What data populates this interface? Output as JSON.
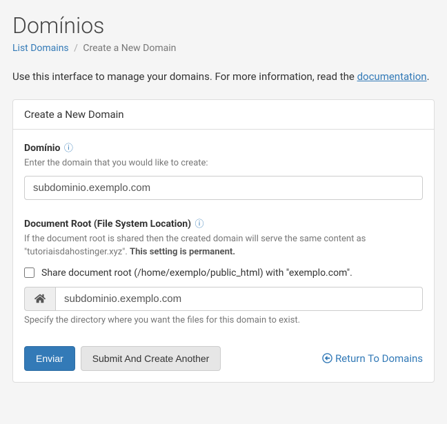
{
  "header": {
    "title": "Domínios",
    "breadcrumb_list_label": "List Domains",
    "breadcrumb_current": "Create a New Domain"
  },
  "description": {
    "prefix": "Use this interface to manage your domains. For more information, read the ",
    "link_label": "documentation",
    "suffix": "."
  },
  "panel": {
    "title": "Create a New Domain",
    "domain": {
      "label": "Domínio",
      "subtext": "Enter the domain that you would like to create:",
      "value": "subdominio.exemplo.com"
    },
    "docroot": {
      "label": "Document Root (File System Location)",
      "subtext_prefix": "If the document root is shared then the created domain will serve the same content as \"tutoriaisdahostinger.xyz\". ",
      "subtext_strong": "This setting is permanent.",
      "share_checkbox_label": "Share document root (/home/exemplo/public_html) with \"exemplo.com\".",
      "path_value": "subdominio.exemplo.com",
      "helptext": "Specify the directory where you want the files for this domain to exist."
    },
    "actions": {
      "submit_label": "Enviar",
      "submit_another_label": "Submit And Create Another",
      "return_label": "Return To Domains"
    }
  }
}
